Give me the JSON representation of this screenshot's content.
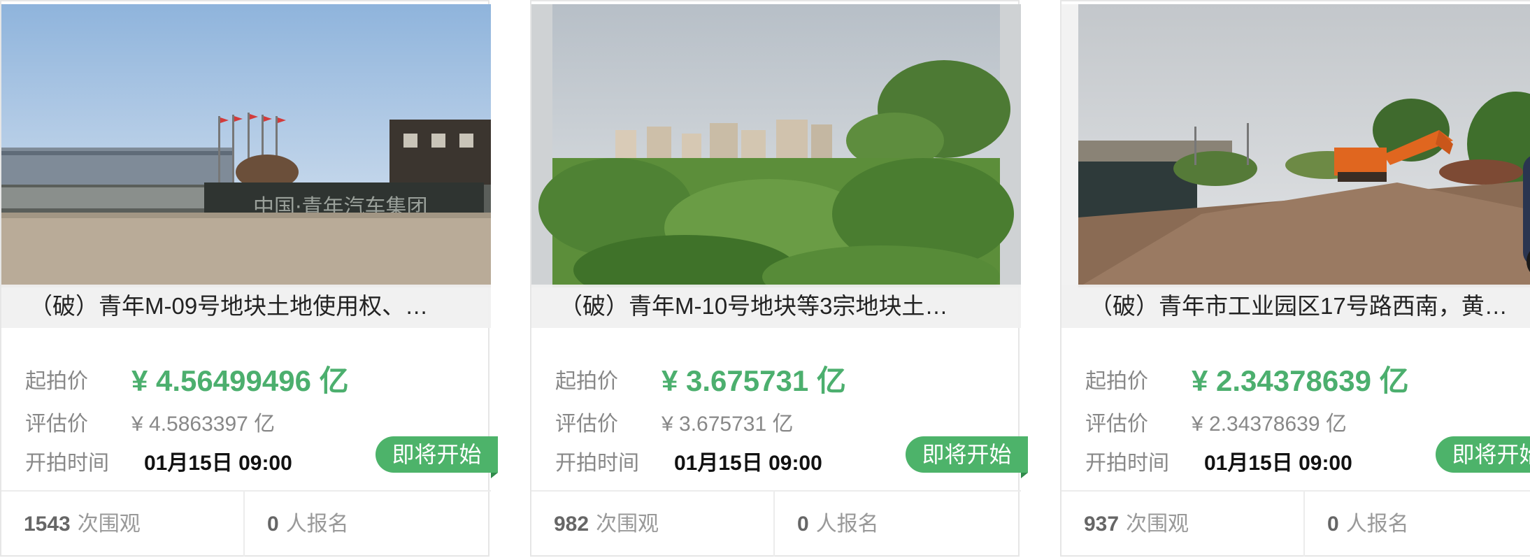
{
  "labels": {
    "start_price": "起拍价",
    "eval_price": "评估价",
    "start_time": "开拍时间",
    "views_suffix": "次围观",
    "signup_suffix": "人报名"
  },
  "cards": [
    {
      "title": "（破）青年M-09号地块土地使用权、…",
      "start_price": "¥ 4.56499496 亿",
      "eval_price": "¥ 4.5863397 亿",
      "start_time": "01月15日 09:00",
      "status": "即将开始",
      "views": "1543",
      "signups": "0",
      "photo_sign_text": "中国·青年汽车集团"
    },
    {
      "title": "（破）青年M-10号地块等3宗地块土…",
      "start_price": "¥ 3.675731 亿",
      "eval_price": "¥ 3.675731 亿",
      "start_time": "01月15日 09:00",
      "status": "即将开始",
      "views": "982",
      "signups": "0"
    },
    {
      "title": "（破）青年市工业园区17号路西南，黄…",
      "start_price": "¥ 2.34378639 亿",
      "eval_price": "¥ 2.34378639 亿",
      "start_time": "01月15日 09:00",
      "status": "即将开始",
      "views": "937",
      "signups": "0"
    }
  ],
  "colors": {
    "price_green": "#4caf6e",
    "badge_green": "#4db36a"
  }
}
